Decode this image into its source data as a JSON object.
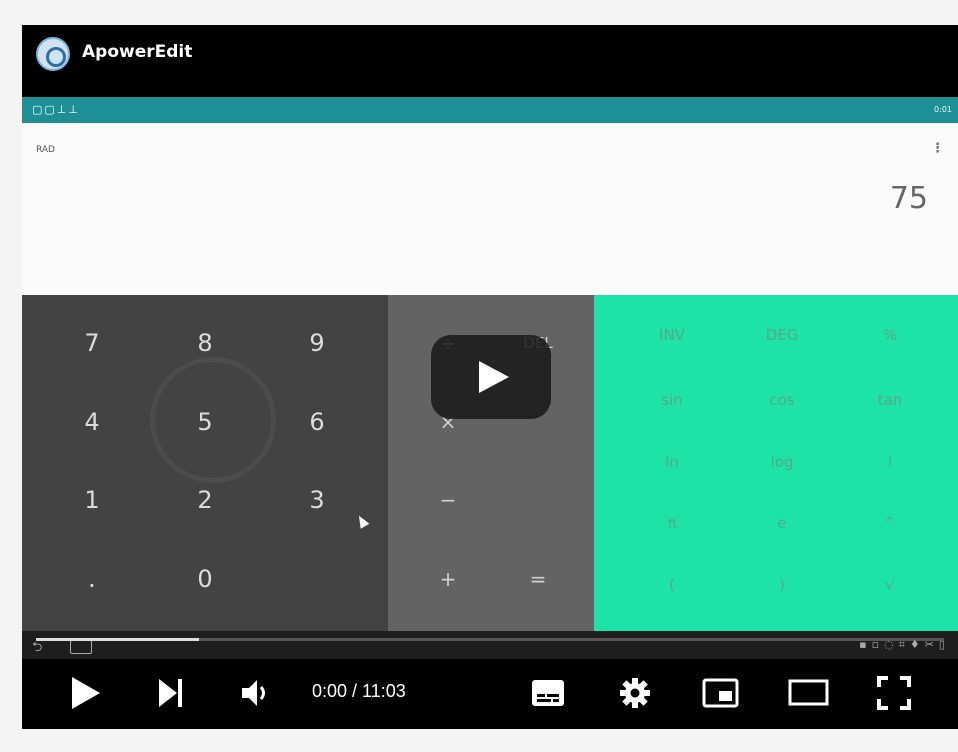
{
  "app": {
    "title": "ApowerEdit"
  },
  "status": {
    "icons": "▢▢⊥⊥",
    "time": "0:01"
  },
  "display": {
    "mode": "RAD",
    "overflow": "⋮",
    "result": "75"
  },
  "numpad": {
    "keys": [
      "7",
      "8",
      "9",
      "4",
      "5",
      "6",
      "1",
      "2",
      "3",
      ".",
      "0"
    ]
  },
  "ops": {
    "keys": [
      "÷",
      "DEL",
      "×",
      "−",
      "+",
      "="
    ]
  },
  "advanced": {
    "keys": [
      "INV",
      "DEG",
      "%",
      "sin",
      "cos",
      "tan",
      "ln",
      "log",
      "!",
      "π",
      "e",
      "^",
      "(",
      ")",
      "√"
    ]
  },
  "player": {
    "time_display": "0:00 / 11:03",
    "progress": 0.18
  },
  "colors": {
    "accent": "#1de3a6",
    "numpad": "#434343",
    "ops": "#636363",
    "statusbar": "#1f8f96"
  }
}
